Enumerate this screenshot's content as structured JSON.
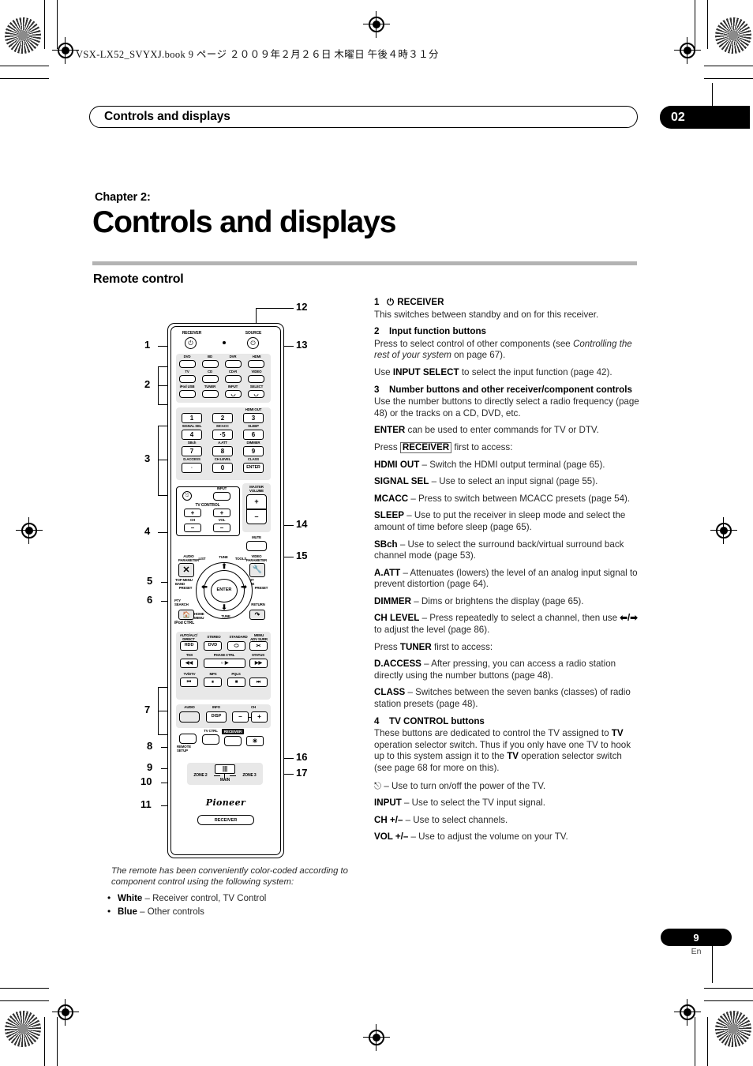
{
  "print": {
    "file_header": "VSX-LX52_SVYXJ.book   9 ページ   ２００９年２月２６日   木曜日   午後４時３１分"
  },
  "running_head": {
    "title": "Controls and displays",
    "chapter_number": "02"
  },
  "titles": {
    "chapter_label": "Chapter 2:",
    "chapter_title": "Controls and displays",
    "section_title": "Remote control"
  },
  "folio": {
    "page": "9",
    "lang": "En"
  },
  "caption": {
    "text": "The remote has been conveniently color-coded according to component control using the following system:",
    "bullets": [
      {
        "term": "White",
        "desc": "– Receiver control, TV Control"
      },
      {
        "term": "Blue",
        "desc": "– Other controls"
      }
    ]
  },
  "items": [
    {
      "num": "1",
      "title": "RECEIVER",
      "title_prefix_icon": "power-icon",
      "body": [
        {
          "type": "p",
          "html": "This switches between standby and on for this receiver."
        }
      ]
    },
    {
      "num": "2",
      "title": "Input function buttons",
      "body": [
        {
          "type": "p",
          "html": "Press to select control of other components (see <i>Controlling the rest of your system</i> on page 67)."
        },
        {
          "type": "p",
          "html": "Use <b>INPUT SELECT</b> to select the input function (page 42)."
        }
      ]
    },
    {
      "num": "3",
      "title": "Number buttons and other receiver/component controls",
      "body": [
        {
          "type": "p",
          "html": "Use the number buttons to directly select a radio frequency (page 48) or the tracks on a CD, DVD, etc."
        },
        {
          "type": "p",
          "html": "<b>ENTER</b> can be used to enter commands for TV or DTV."
        },
        {
          "type": "p",
          "html": "Press <span class=\"keybox\">RECEIVER</span> first to access:"
        },
        {
          "type": "sub",
          "html": "<b>HDMI OUT</b> – Switch the HDMI output terminal (page 65)."
        },
        {
          "type": "sub",
          "html": "<b>SIGNAL SEL</b> – Use to select an input signal (page 55)."
        },
        {
          "type": "sub",
          "html": "<b>MCACC</b> – Press to switch between MCACC presets (page 54)."
        },
        {
          "type": "sub",
          "html": "<b>SLEEP</b> – Use to put the receiver in sleep mode and select the amount of time before sleep (page 65)."
        },
        {
          "type": "sub",
          "html": "<b>SBch</b> – Use to select the surround back/virtual surround back channel mode (page 53)."
        },
        {
          "type": "sub",
          "html": "<b>A.ATT</b> – Attenuates (lowers) the level of an analog input signal to prevent distortion (page 64)."
        },
        {
          "type": "sub",
          "html": "<b>DIMMER</b> – Dims or brightens the display (page 65)."
        },
        {
          "type": "sub",
          "html": "<b>CH LEVEL</b> – Press repeatedly to select a channel, then use <b>&#11013;/&#10145;</b> to adjust the level (page 86)."
        },
        {
          "type": "p",
          "html": "Press <b>TUNER</b> first to access:"
        },
        {
          "type": "sub",
          "html": "<b>D.ACCESS</b> – After pressing, you can access a radio station directly using the number buttons (page 48)."
        },
        {
          "type": "sub",
          "html": "<b>CLASS</b> – Switches between the seven banks (classes) of radio station presets (page 48)."
        }
      ]
    },
    {
      "num": "4",
      "title": "TV CONTROL buttons",
      "body": [
        {
          "type": "p",
          "html": "These buttons are dedicated to control the TV assigned to <b>TV</b> operation selector switch. Thus if you only have one TV to hook up to this system assign it to the <b>TV</b> operation selector switch (see page 68 for more on this)."
        },
        {
          "type": "sub",
          "html": "<span class=\"pwr\">&#9099;</span> – Use to turn on/off the power of the TV."
        },
        {
          "type": "sub",
          "html": "<b>INPUT</b> – Use to select the TV input signal."
        },
        {
          "type": "sub",
          "html": "<b>CH +/&#8211;</b> – Use to select channels."
        },
        {
          "type": "sub",
          "html": "<b>VOL +/&#8211;</b> – Use to adjust the volume on your TV."
        }
      ]
    }
  ],
  "remote": {
    "callouts_left": [
      "1",
      "2",
      "3",
      "4",
      "5",
      "6",
      "7",
      "8",
      "9",
      "10",
      "11"
    ],
    "callouts_right": [
      "12",
      "13",
      "14",
      "15",
      "16",
      "17"
    ],
    "top": {
      "receiver_label": "RECEIVER",
      "source_label": "SOURCE",
      "power_glyph": "⏻"
    },
    "input_function_rows": [
      [
        "DVD",
        "BD",
        "DVR",
        "HDMI"
      ],
      [
        "TV",
        "CD",
        "CD-R",
        "VIDEO"
      ],
      [
        "iPod USB",
        "TUNER",
        "INPUT",
        "SELECT"
      ]
    ],
    "numpad": {
      "labels_above": [
        "",
        "",
        "HDMI OUT",
        "SIGNAL SEL",
        "MCACC",
        "SLEEP",
        "SBch",
        "A.ATT",
        "DIMMER",
        "D.ACCESS",
        "CH LEVEL",
        "CLASS"
      ],
      "keys": [
        "1",
        "2",
        "3",
        "4",
        "·5",
        "6",
        "7",
        "8",
        "9",
        "◦",
        "0",
        "ENTER"
      ]
    },
    "tv_control": {
      "group_label": "TV CONTROL",
      "input_label": "INPUT",
      "ch_label": "CH",
      "vol_label": "VOL",
      "plus": "+",
      "minus": "–"
    },
    "master_volume": {
      "label": "MASTER VOLUME",
      "plus": "+",
      "minus": "–"
    },
    "mute_label": "MUTE",
    "audio_parameter_label": "AUDIO PARAMETER",
    "video_parameter_label": "VIDEO PARAMETER",
    "nav": {
      "list": "LIST",
      "tune_top": "TUNE",
      "tools": "TOOLS",
      "top_menu_band": "TOP MENU BAND",
      "t_edit_guide": "T.EDIT GUIDE",
      "preset_left": "PRESET",
      "preset_right": "PRESET",
      "enter": "ENTER",
      "pty_search": "PTY SEARCH",
      "home_menu": "HOME MENU",
      "tune_bottom": "TUNE",
      "return": "RETURN",
      "ipod_ctrl": "iPod CTRL"
    },
    "mode_row_labels": [
      "AUTO/ALC/ DIRECT",
      "STEREO",
      "STANDARD",
      "MENU ADV SURR"
    ],
    "mode_row_keys": [
      "HDD",
      "DVD",
      "⬭",
      "✂"
    ],
    "transport1_labels": [
      "THX",
      "PHASE CTRL",
      "STATUS"
    ],
    "transport1_keys": [
      "◀◀",
      "○  ▶",
      "▶▶"
    ],
    "transport2_labels": [
      "TV/DTV",
      "MPX",
      "PQLS"
    ],
    "transport2_keys": [
      "⏮",
      "⏸",
      "■",
      "⏭"
    ],
    "bottom_row": {
      "audio": "AUDIO",
      "info": "INFO",
      "disp": "DISP",
      "ch": "CH",
      "minus": "–",
      "plus": "+"
    },
    "final_row": {
      "remote_setup": "REMOTE SETUP",
      "tv_ctrl": "TV CTRL",
      "receiver": "RECEIVER",
      "light": "☀"
    },
    "zone_switch": {
      "left": "ZONE 2",
      "right": "ZONE 3",
      "center": "MAIN"
    },
    "brand": "Pioneer",
    "brand_sub": "RECEIVER"
  }
}
